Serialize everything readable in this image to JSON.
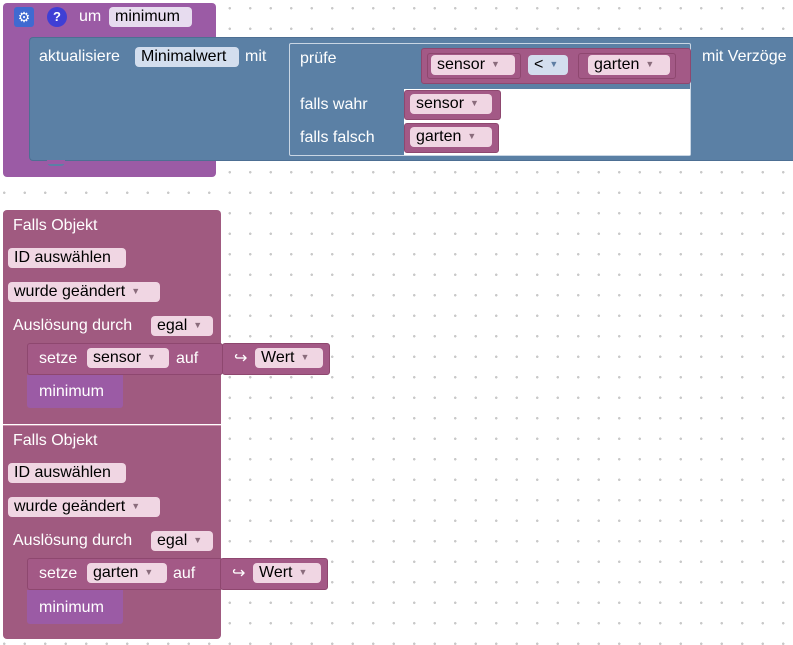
{
  "procedure": {
    "prefix": "um",
    "name": "minimum",
    "gear_icon": "gear-icon",
    "help_icon": "question-icon"
  },
  "update": {
    "label": "aktualisiere",
    "variable": "Minimalwert",
    "with": "mit",
    "delay_label": "mit Verzöge"
  },
  "ternary": {
    "check": "prüfe",
    "if_true": "falls wahr",
    "if_false": "falls falsch",
    "cond_left": "sensor",
    "operator": "<",
    "cond_right": "garten",
    "true_value": "sensor",
    "false_value": "garten"
  },
  "triggers": [
    {
      "title": "Falls Objekt",
      "id_button": "ID auswählen",
      "change": "wurde geändert",
      "trigger_label": "Auslösung durch",
      "trigger_value": "egal",
      "set_label": "setze",
      "variable": "sensor",
      "to_label": "auf",
      "value_icon": "↪",
      "value": "Wert",
      "call": "minimum"
    },
    {
      "title": "Falls Objekt",
      "id_button": "ID auswählen",
      "change": "wurde geändert",
      "trigger_label": "Auslösung durch",
      "trigger_value": "egal",
      "set_label": "setze",
      "variable": "garten",
      "to_label": "auf",
      "value_icon": "↪",
      "value": "Wert",
      "call": "minimum"
    }
  ],
  "colors": {
    "procedure": "#9b5ba5",
    "update_block": "#5b80a5",
    "variable_block": "#a35986",
    "trigger_block": "#a05a80"
  }
}
